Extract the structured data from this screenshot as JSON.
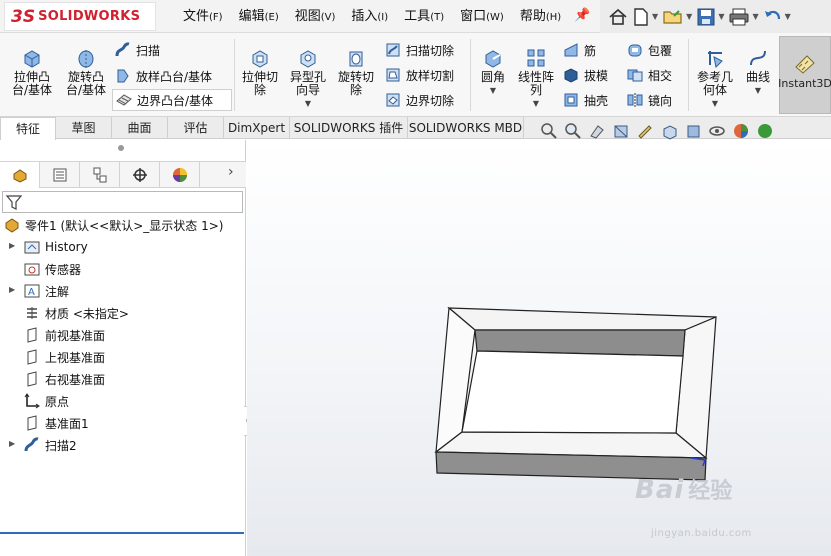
{
  "app": {
    "logo_mark": "3S",
    "logo_text": "SOLIDWORKS"
  },
  "menu": [
    {
      "label": "文件",
      "key": "(F)"
    },
    {
      "label": "编辑",
      "key": "(E)"
    },
    {
      "label": "视图",
      "key": "(V)"
    },
    {
      "label": "插入",
      "key": "(I)"
    },
    {
      "label": "工具",
      "key": "(T)"
    },
    {
      "label": "窗口",
      "key": "(W)"
    },
    {
      "label": "帮助",
      "key": "(H)"
    }
  ],
  "quick_access": [
    "home-icon",
    "new-document-icon",
    "open-folder-icon",
    "save-icon",
    "print-icon",
    "undo-icon"
  ],
  "ribbon": {
    "extrude_boss": "拉伸凸\n台/基体",
    "revolve_boss": "旋转凸\n台/基体",
    "sweep": "扫描",
    "loft_boss": "放样凸台/基体",
    "boundary_boss": "边界凸台/基体",
    "extrude_cut": "拉伸切\n除",
    "hole_wizard": "异型孔\n向导",
    "revolve_cut": "旋转切\n除",
    "sweep_cut": "扫描切除",
    "loft_cut": "放样切割",
    "boundary_cut": "边界切除",
    "fillet": "圆角",
    "linear_pattern": "线性阵\n列",
    "rib": "筋",
    "draft": "拔模",
    "shell": "抽壳",
    "wrap": "包覆",
    "intersect": "相交",
    "mirror": "镜向",
    "reference_geometry": "参考几\n何体",
    "curves": "曲线",
    "instant3d": "Instant3D"
  },
  "tabs": [
    "特征",
    "草图",
    "曲面",
    "评估",
    "DimXpert",
    "SOLIDWORKS 插件",
    "SOLIDWORKS MBD"
  ],
  "tree": {
    "root": "零件1 (默认<<默认>_显示状态 1>)",
    "items": [
      {
        "label": "History",
        "expandable": true
      },
      {
        "label": "传感器",
        "expandable": false
      },
      {
        "label": "注解",
        "expandable": true
      },
      {
        "label": "材质 <未指定>",
        "expandable": false
      },
      {
        "label": "前视基准面",
        "expandable": false
      },
      {
        "label": "上视基准面",
        "expandable": false
      },
      {
        "label": "右视基准面",
        "expandable": false
      },
      {
        "label": "原点",
        "expandable": false
      },
      {
        "label": "基准面1",
        "expandable": false
      },
      {
        "label": "扫描2",
        "expandable": true
      }
    ]
  },
  "watermark": {
    "brand": "Bai",
    "brand_cn": "经验",
    "url": "jingyan.baidu.com"
  },
  "colors": {
    "accent": "#2f6db5",
    "logo_red": "#d1202f",
    "tab_bg": "#ececec"
  }
}
